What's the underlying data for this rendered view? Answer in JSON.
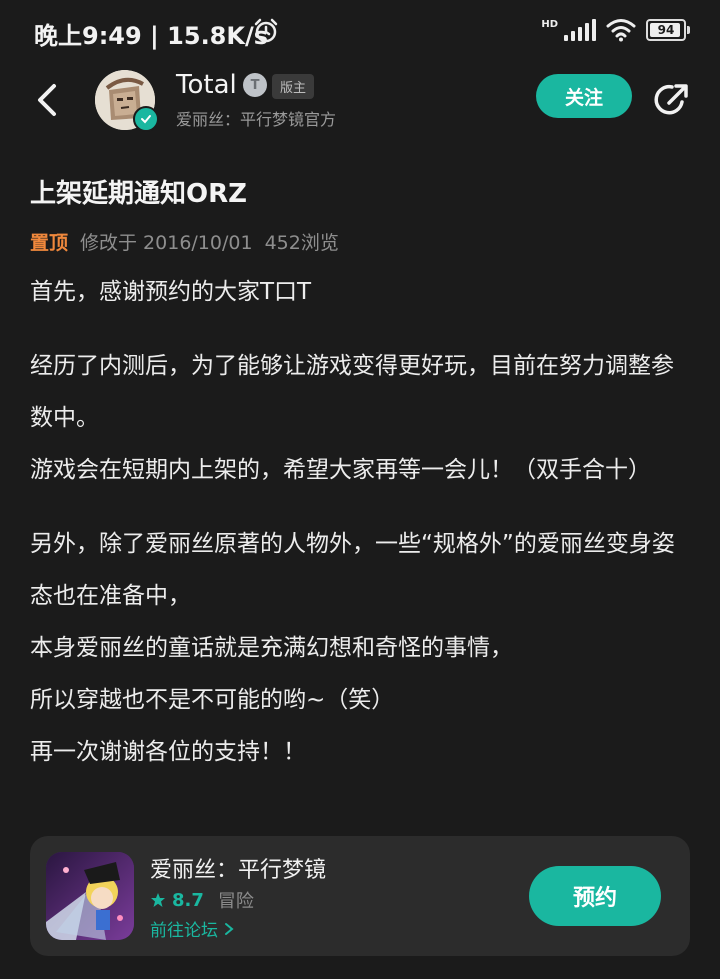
{
  "status_bar": {
    "time": "晚上9:49 | 15.8K/s",
    "network_label": "HD",
    "battery": "94",
    "battery_level": 0.94
  },
  "header": {
    "username": "Total",
    "user_badge": "T",
    "role_tag": "版主",
    "subtitle": "爱丽丝：平行梦镜官方",
    "follow_label": "关注"
  },
  "post": {
    "title": "上架延期通知ORZ",
    "pinned": "置顶",
    "modified": "修改于 2016/10/01",
    "views": "452浏览",
    "paragraphs": [
      "首先，感谢预约的大家T口T",
      "经历了内测后，为了能够让游戏变得更好玩，目前在努力调整参数中。",
      "游戏会在短期内上架的，希望大家再等一会儿！（双手合十）",
      "另外，除了爱丽丝原著的人物外，一些“规格外”的爱丽丝变身姿态也在准备中，",
      "本身爱丽丝的童话就是充满幻想和奇怪的事情，",
      "所以穿越也不是不可能的哟~（笑）",
      "再一次谢谢各位的支持！！"
    ]
  },
  "app_card": {
    "name": "爱丽丝：平行梦镜",
    "rating": "8.7",
    "genre": "冒险",
    "forum_link": "前往论坛",
    "reserve_label": "预约"
  },
  "colors": {
    "accent": "#1ab7a0",
    "pinned": "#f0883c",
    "background": "#1b1b1b",
    "card": "#2c2c2c"
  }
}
